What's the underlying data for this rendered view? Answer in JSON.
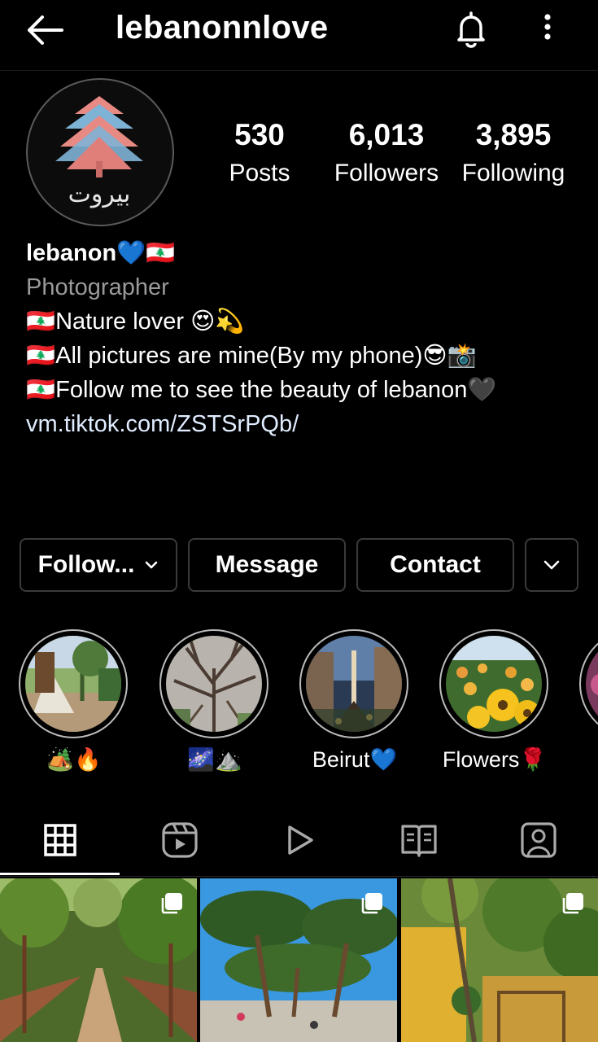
{
  "header": {
    "username": "lebanonnlove",
    "back_icon": "arrow-left-icon",
    "bell_icon": "bell-icon",
    "more_icon": "more-vertical-icon"
  },
  "avatar": {
    "text": "بيروت"
  },
  "stats": [
    {
      "value": "530",
      "label": "Posts"
    },
    {
      "value": "6,013",
      "label": "Followers"
    },
    {
      "value": "3,895",
      "label": "Following"
    }
  ],
  "bio": {
    "name": "lebanon💙🇱🇧",
    "category": "Photographer",
    "lines": [
      "🇱🇧Nature lover 😍💫",
      "🇱🇧All pictures are mine(By my phone)😎📸",
      "🇱🇧Follow me to see the beauty of lebanon🖤"
    ],
    "link": "vm.tiktok.com/ZSTSrPQb/"
  },
  "actions": {
    "follow_label": "Follow...",
    "message_label": "Message",
    "contact_label": "Contact"
  },
  "highlights": [
    {
      "label": "🏕️🔥"
    },
    {
      "label": "🌌⛰️"
    },
    {
      "label": "Beirut💙"
    },
    {
      "label": "Flowers🌹"
    }
  ],
  "tabs": [
    {
      "icon": "grid-icon",
      "active": true
    },
    {
      "icon": "reels-icon",
      "active": false
    },
    {
      "icon": "play-icon",
      "active": false
    },
    {
      "icon": "guide-icon",
      "active": false
    },
    {
      "icon": "tagged-icon",
      "active": false
    }
  ],
  "colors": {
    "background": "#000000",
    "text": "#ffffff",
    "secondary_text": "#9a9a9a",
    "border": "#3a3a3a"
  }
}
